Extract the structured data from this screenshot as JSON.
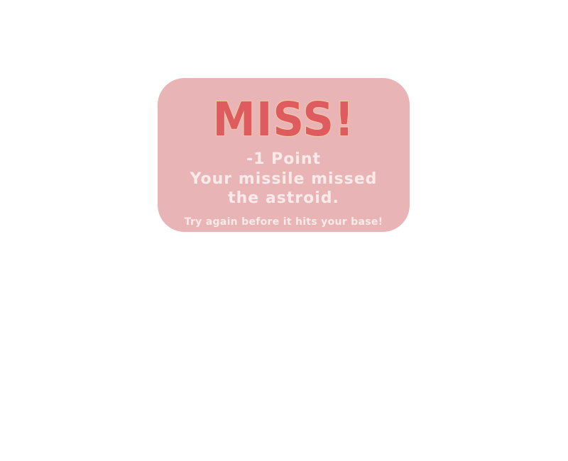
{
  "dialog": {
    "title": "MISS!",
    "points": "-1 Point",
    "message": "Your missile missed the astroid.",
    "hint": "Try again before it hits your base!"
  },
  "colors": {
    "card_background": "#e8b4b5",
    "title_fill": "#de5c60",
    "title_outline": "#f6cfa0",
    "text": "#fbeaea",
    "page_background": "#ffffff"
  }
}
